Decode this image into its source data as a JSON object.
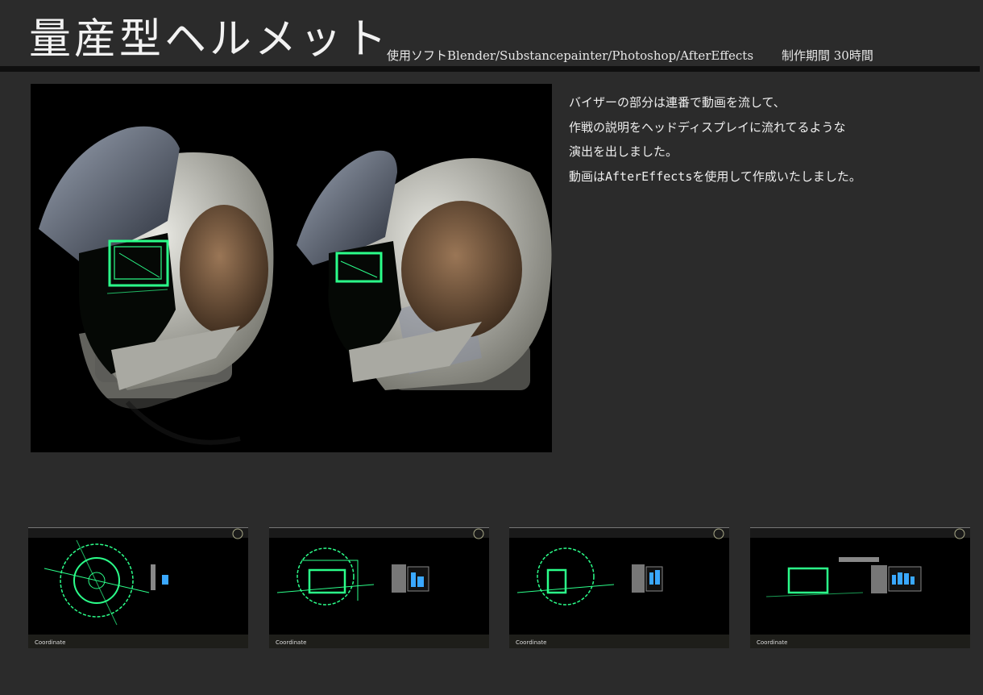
{
  "header": {
    "title": "量産型ヘルメット",
    "software": "使用ソフトBlender/Substancepainter/Photoshop/AfterEffects",
    "period": "制作期間 30時間"
  },
  "description": {
    "lines": [
      "バイザーの部分は連番で動画を流して、",
      "作戦の説明をヘッドディスプレイに流れてるような",
      "演出を出しました。",
      "動画はAfterEffectsを使用して作成いたしました。"
    ]
  },
  "thumbnails": {
    "hud_label": "Coordinate"
  },
  "colors": {
    "background": "#2b2b2b",
    "hud_green": "#2bff8a",
    "hud_blue": "#3aa8ff"
  }
}
